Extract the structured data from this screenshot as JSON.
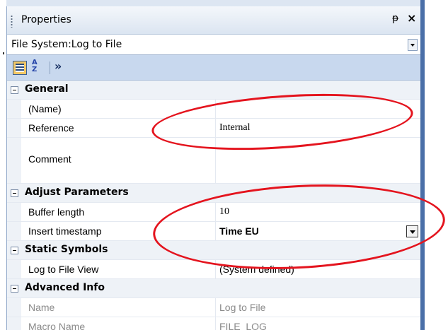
{
  "panel": {
    "title": "Properties",
    "pin_glyph": "ᵽ",
    "close_glyph": "×"
  },
  "object_select": {
    "value": "File System:Log to File"
  },
  "toolbar": {
    "alpha_top": "A",
    "alpha_bottom": "Z",
    "more": "»"
  },
  "categories": {
    "general": "General",
    "adjust": "Adjust Parameters",
    "static": "Static Symbols",
    "advanced": "Advanced Info"
  },
  "properties": {
    "name": {
      "label": "(Name)",
      "value": ""
    },
    "reference": {
      "label": "Reference",
      "value": "Internal"
    },
    "comment": {
      "label": "Comment",
      "value": ""
    },
    "buffer_length": {
      "label": "Buffer length",
      "value": "10"
    },
    "insert_timestamp": {
      "label": "Insert timestamp",
      "value": "Time EU"
    },
    "log_view": {
      "label": "Log to File  View",
      "value": "(System defined)"
    },
    "adv_name": {
      "label": "Name",
      "value": "Log to File"
    },
    "macro_name": {
      "label": "Macro Name",
      "value": "FILE_LOG"
    }
  },
  "colors": {
    "annotation": "#e4141e",
    "frame": "#4a6fa8",
    "toolbar": "#c8d8ee"
  }
}
